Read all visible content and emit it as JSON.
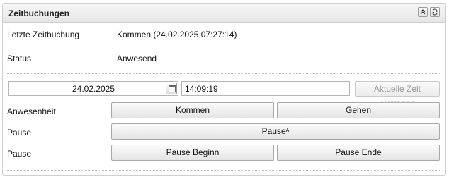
{
  "panel": {
    "title": "Zeitbuchungen",
    "collapse_icon": "double-chevron-up-icon",
    "refresh_icon": "refresh-icon"
  },
  "info": {
    "last_booking_label": "Letzte Zeitbuchung",
    "last_booking_value": "Kommen (24.02.2025 07:27:14)",
    "status_label": "Status",
    "status_value": "Anwesend"
  },
  "entry": {
    "date_value": "24.02.2025",
    "calendar_icon": "calendar-icon",
    "time_value": "14:09:19",
    "current_time_label": "Aktuelle Zeit eintragen"
  },
  "rows": {
    "presence_label": "Anwesenheit",
    "come_label": "Kommen",
    "go_label": "Gehen",
    "pause_label": "Pause",
    "pause_button_label": "Pause",
    "pause_button_accent": "A",
    "pause2_label": "Pause",
    "pause_begin_label": "Pause Beginn",
    "pause_end_label": "Pause Ende"
  }
}
